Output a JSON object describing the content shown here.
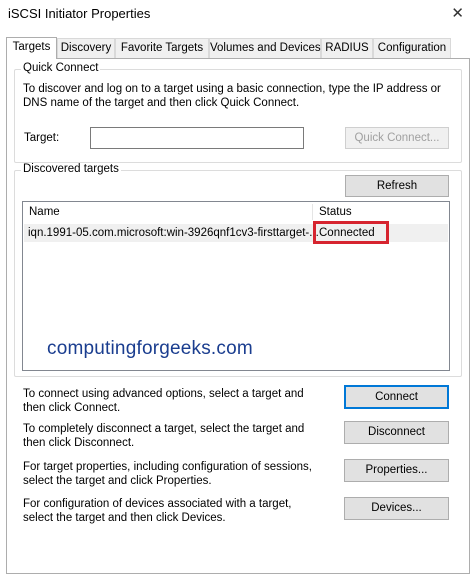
{
  "window": {
    "title": "iSCSI Initiator Properties",
    "close_glyph": "✕"
  },
  "tabs": [
    {
      "label": "Targets",
      "active": true
    },
    {
      "label": "Discovery"
    },
    {
      "label": "Favorite Targets"
    },
    {
      "label": "Volumes and Devices"
    },
    {
      "label": "RADIUS"
    },
    {
      "label": "Configuration"
    }
  ],
  "quick_connect": {
    "group_label": "Quick Connect",
    "description": "To discover and log on to a target using a basic connection, type the IP address or DNS name of the target and then click Quick Connect.",
    "target_label": "Target:",
    "target_value": "",
    "button_label": "Quick Connect..."
  },
  "discovered": {
    "group_label": "Discovered targets",
    "refresh_label": "Refresh",
    "columns": [
      "Name",
      "Status"
    ],
    "rows": [
      {
        "name": "iqn.1991-05.com.microsoft:win-3926qnf1cv3-firsttarget-...",
        "status": "Connected"
      }
    ]
  },
  "watermark": "computingforgeeks.com",
  "actions": [
    {
      "text": "To connect using advanced options, select a target and then click Connect.",
      "button": "Connect"
    },
    {
      "text": "To completely disconnect a target, select the target and then click Disconnect.",
      "button": "Disconnect"
    },
    {
      "text": "For target properties, including configuration of sessions, select the target and click Properties.",
      "button": "Properties..."
    },
    {
      "text": "For configuration of devices associated with a target, select the target and then click Devices.",
      "button": "Devices..."
    }
  ],
  "colors": {
    "highlight": "#d6242f",
    "default_button_border": "#0078d7",
    "watermark": "#1a3d8f"
  }
}
